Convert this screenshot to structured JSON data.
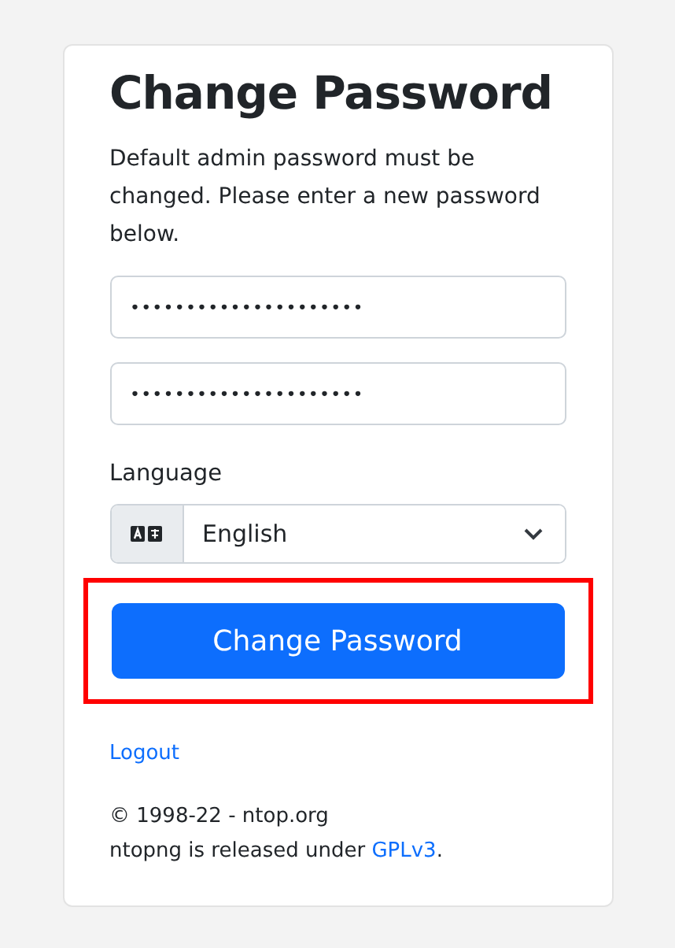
{
  "title": "Change Password",
  "description": "Default admin password must be changed. Please enter a new password below.",
  "password_fields": [
    {
      "value": "•••••••••••••••••••••"
    },
    {
      "value": "•••••••••••••••••••••"
    }
  ],
  "language": {
    "label": "Language",
    "value": "English"
  },
  "submit_button": {
    "label": "Change Password",
    "highlighted": true
  },
  "logout_link": "Logout",
  "footer": {
    "copyright": "© 1998-22 - ntop.org",
    "license_before": "ntopng is released under ",
    "license_link": "GPLv3",
    "license_after": "."
  }
}
